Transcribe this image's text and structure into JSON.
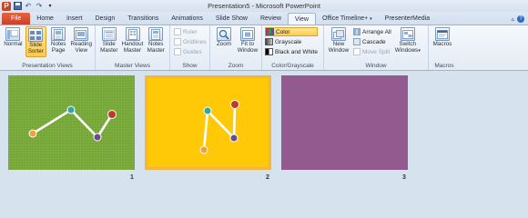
{
  "window": {
    "title": "Presentation5  -  Microsoft PowerPoint",
    "qat_icons": [
      "app-icon",
      "save-icon",
      "undo-icon",
      "redo-icon",
      "qat-customize-icon"
    ]
  },
  "tabs": {
    "file": "File",
    "home": "Home",
    "insert": "Insert",
    "design": "Design",
    "transitions": "Transitions",
    "animations": "Animations",
    "slideshow": "Slide Show",
    "review": "Review",
    "view": "View",
    "officetimeline": "Office Timeline+",
    "presentermedia": "PresenterMedia"
  },
  "ribbon": {
    "presentation_views": {
      "label": "Presentation Views",
      "normal": "Normal",
      "slide_sorter_1": "Slide",
      "slide_sorter_2": "Sorter",
      "notes_page_1": "Notes",
      "notes_page_2": "Page",
      "reading_view_1": "Reading",
      "reading_view_2": "View"
    },
    "master_views": {
      "label": "Master Views",
      "slide_master_1": "Slide",
      "slide_master_2": "Master",
      "handout_master_1": "Handout",
      "handout_master_2": "Master",
      "notes_master_1": "Notes",
      "notes_master_2": "Master"
    },
    "show": {
      "label": "Show",
      "ruler": "Ruler",
      "gridlines": "Gridlines",
      "guides": "Guides"
    },
    "zoom": {
      "label": "Zoom",
      "zoom": "Zoom",
      "fit_1": "Fit to",
      "fit_2": "Window"
    },
    "color": {
      "label": "Color/Grayscale",
      "color": "Color",
      "grayscale": "Grayscale",
      "bw": "Black and White"
    },
    "window": {
      "label": "Window",
      "new_1": "New",
      "new_2": "Window",
      "arrange": "Arrange All",
      "cascade": "Cascade",
      "move_split": "Move Split",
      "switch_1": "Switch",
      "switch_2": "Windows"
    },
    "macros": {
      "label": "Macros",
      "macros": "Macros"
    }
  },
  "slides": [
    {
      "number": "1",
      "background": "#73a633"
    },
    {
      "number": "2",
      "background": "#ffc908"
    },
    {
      "number": "3",
      "background": "#925a8f"
    }
  ],
  "colors": {
    "file_tab": "#c8422a",
    "selected": "#ffc94d",
    "node_orange": "#f2a03d",
    "node_teal": "#2fa7a5",
    "node_purple": "#6b4a94",
    "node_red": "#c0392b"
  }
}
